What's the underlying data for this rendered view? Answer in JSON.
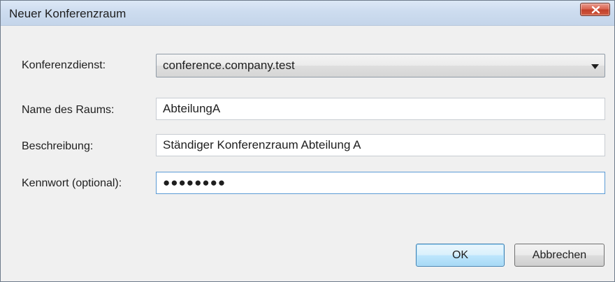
{
  "dialog": {
    "title": "Neuer Konferenzraum"
  },
  "form": {
    "conference_service": {
      "label": "Konferenzdienst:",
      "value": "conference.company.test"
    },
    "room_name": {
      "label": "Name des Raums:",
      "value": "AbteilungA"
    },
    "description": {
      "label": "Beschreibung:",
      "value": "Ständiger Konferenzraum Abteilung A"
    },
    "password": {
      "label": "Kennwort (optional):",
      "value_masked": "●●●●●●●●"
    }
  },
  "buttons": {
    "ok": "OK",
    "cancel": "Abbrechen"
  },
  "icons": {
    "close": "close-icon",
    "dropdown": "chevron-down-icon"
  },
  "colors": {
    "titlebar": "#cddcef",
    "close_button": "#d8624f",
    "default_button": "#bee6fd",
    "focus_border": "#5b9bd5"
  }
}
